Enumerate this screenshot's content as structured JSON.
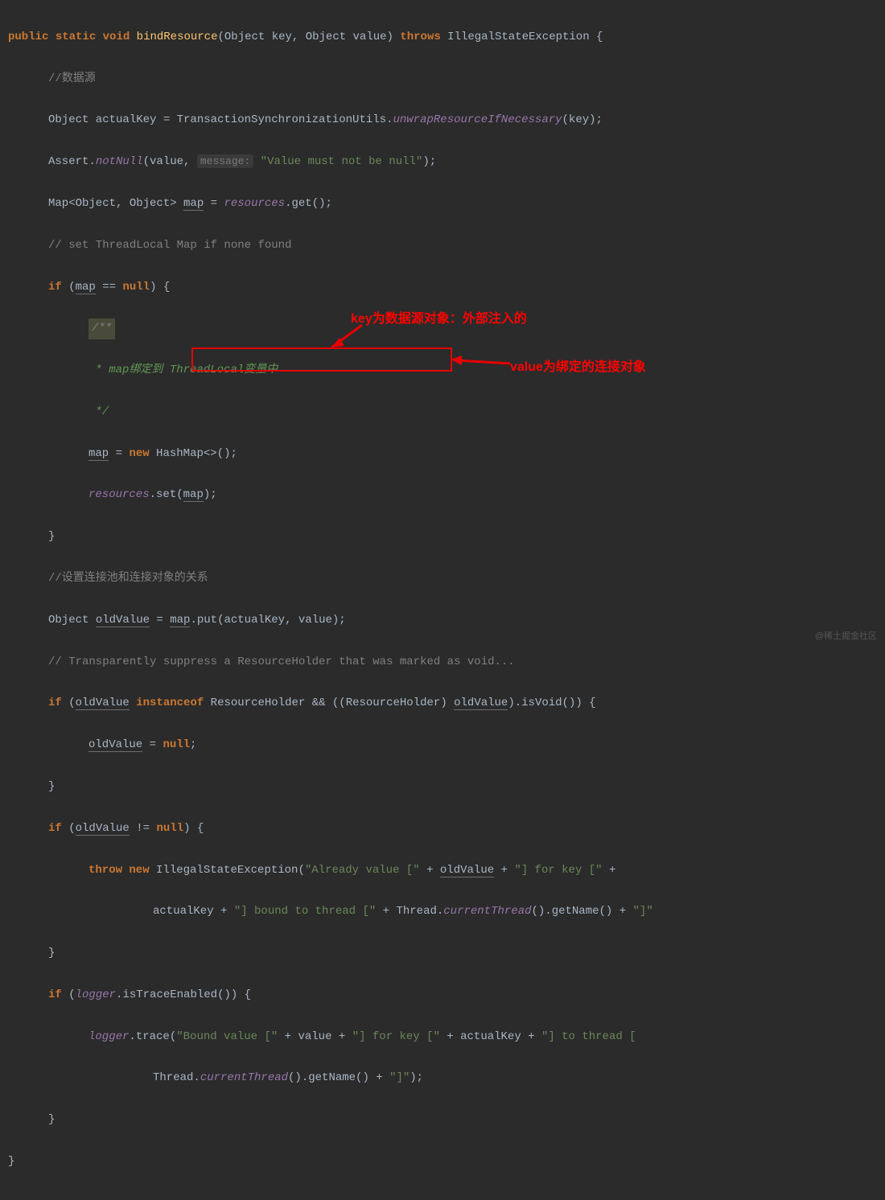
{
  "code": {
    "l1_kw1": "public",
    "l1_kw2": "static",
    "l1_kw3": "void",
    "l1_method": "bindResource",
    "l1_rest": "(Object key, Object value) ",
    "l1_kw4": "throws",
    "l1_exc": " IllegalStateException {",
    "l2": "//数据源",
    "l3a": "Object actualKey = TransactionSynchronizationUtils.",
    "l3b": "unwrapResourceIfNecessary",
    "l3c": "(key);",
    "l4a": "Assert.",
    "l4b": "notNull",
    "l4c": "(value, ",
    "l4hint": "message:",
    "l4d": " ",
    "l4str": "\"Value must not be null\"",
    "l4e": ");",
    "l5a": "Map<Object, Object> ",
    "l5b": "map",
    "l5c": " = ",
    "l5d": "resources",
    "l5e": ".get();",
    "l6": "// set ThreadLocal Map if none found",
    "l7a": "if",
    "l7b": " (",
    "l7c": "map",
    "l7d": " == ",
    "l7e": "null",
    "l7f": ") {",
    "l8": "/**",
    "l9a": " * ",
    "l9b": "map",
    "l9c": "绑定到 ",
    "l9d": "ThreadLocal",
    "l9e": "变量中",
    "l10": " */",
    "l11a": "map",
    "l11b": " = ",
    "l11c": "new",
    "l11d": " HashMap<>();",
    "l12a": "resources",
    "l12b": ".set(",
    "l12c": "map",
    "l12d": ");",
    "l13": "}",
    "l14": "//设置连接池和连接对象的关系",
    "l15a": "Object ",
    "l15b": "oldValue",
    "l15c": " = ",
    "l15d": "map",
    "l15e": ".put(actualKey, value);",
    "l16": "// Transparently suppress a ResourceHolder that was marked as void...",
    "l17a": "if",
    "l17b": " (",
    "l17c": "oldValue",
    "l17d": " ",
    "l17e": "instanceof",
    "l17f": " ResourceHolder && ((ResourceHolder) ",
    "l17g": "oldValue",
    "l17h": ").isVoid()) {",
    "l18a": "oldValue",
    "l18b": " = ",
    "l18c": "null",
    "l18d": ";",
    "l19": "}",
    "l20a": "if",
    "l20b": " (",
    "l20c": "oldValue",
    "l20d": " != ",
    "l20e": "null",
    "l20f": ") {",
    "l21a": "throw new",
    "l21b": " IllegalStateException(",
    "l21c": "\"Already value [\"",
    "l21d": " + ",
    "l21e": "oldValue",
    "l21f": " + ",
    "l21g": "\"] for key [\"",
    "l21h": " +",
    "l22a": "actualKey + ",
    "l22b": "\"] bound to thread [\"",
    "l22c": " + Thread.",
    "l22d": "currentThread",
    "l22e": "().getName() + ",
    "l22f": "\"]\"",
    "l23": "}",
    "l24a": "if",
    "l24b": " (",
    "l24c": "logger",
    "l24d": ".isTraceEnabled()) {",
    "l25a": "logger",
    "l25b": ".trace(",
    "l25c": "\"Bound value [\"",
    "l25d": " + value + ",
    "l25e": "\"] for key [\"",
    "l25f": " + actualKey + ",
    "l25g": "\"] to thread [",
    "l26a": "Thread.",
    "l26b": "currentThread",
    "l26c": "().getName() + ",
    "l26d": "\"]\"",
    "l26e": ");",
    "l27": "}",
    "l28": "}"
  },
  "annotations": {
    "key_label": "key为数据源对象：外部注入的",
    "value_label": "value为绑定的连接对象"
  },
  "watermark": "@稀土掘金社区"
}
